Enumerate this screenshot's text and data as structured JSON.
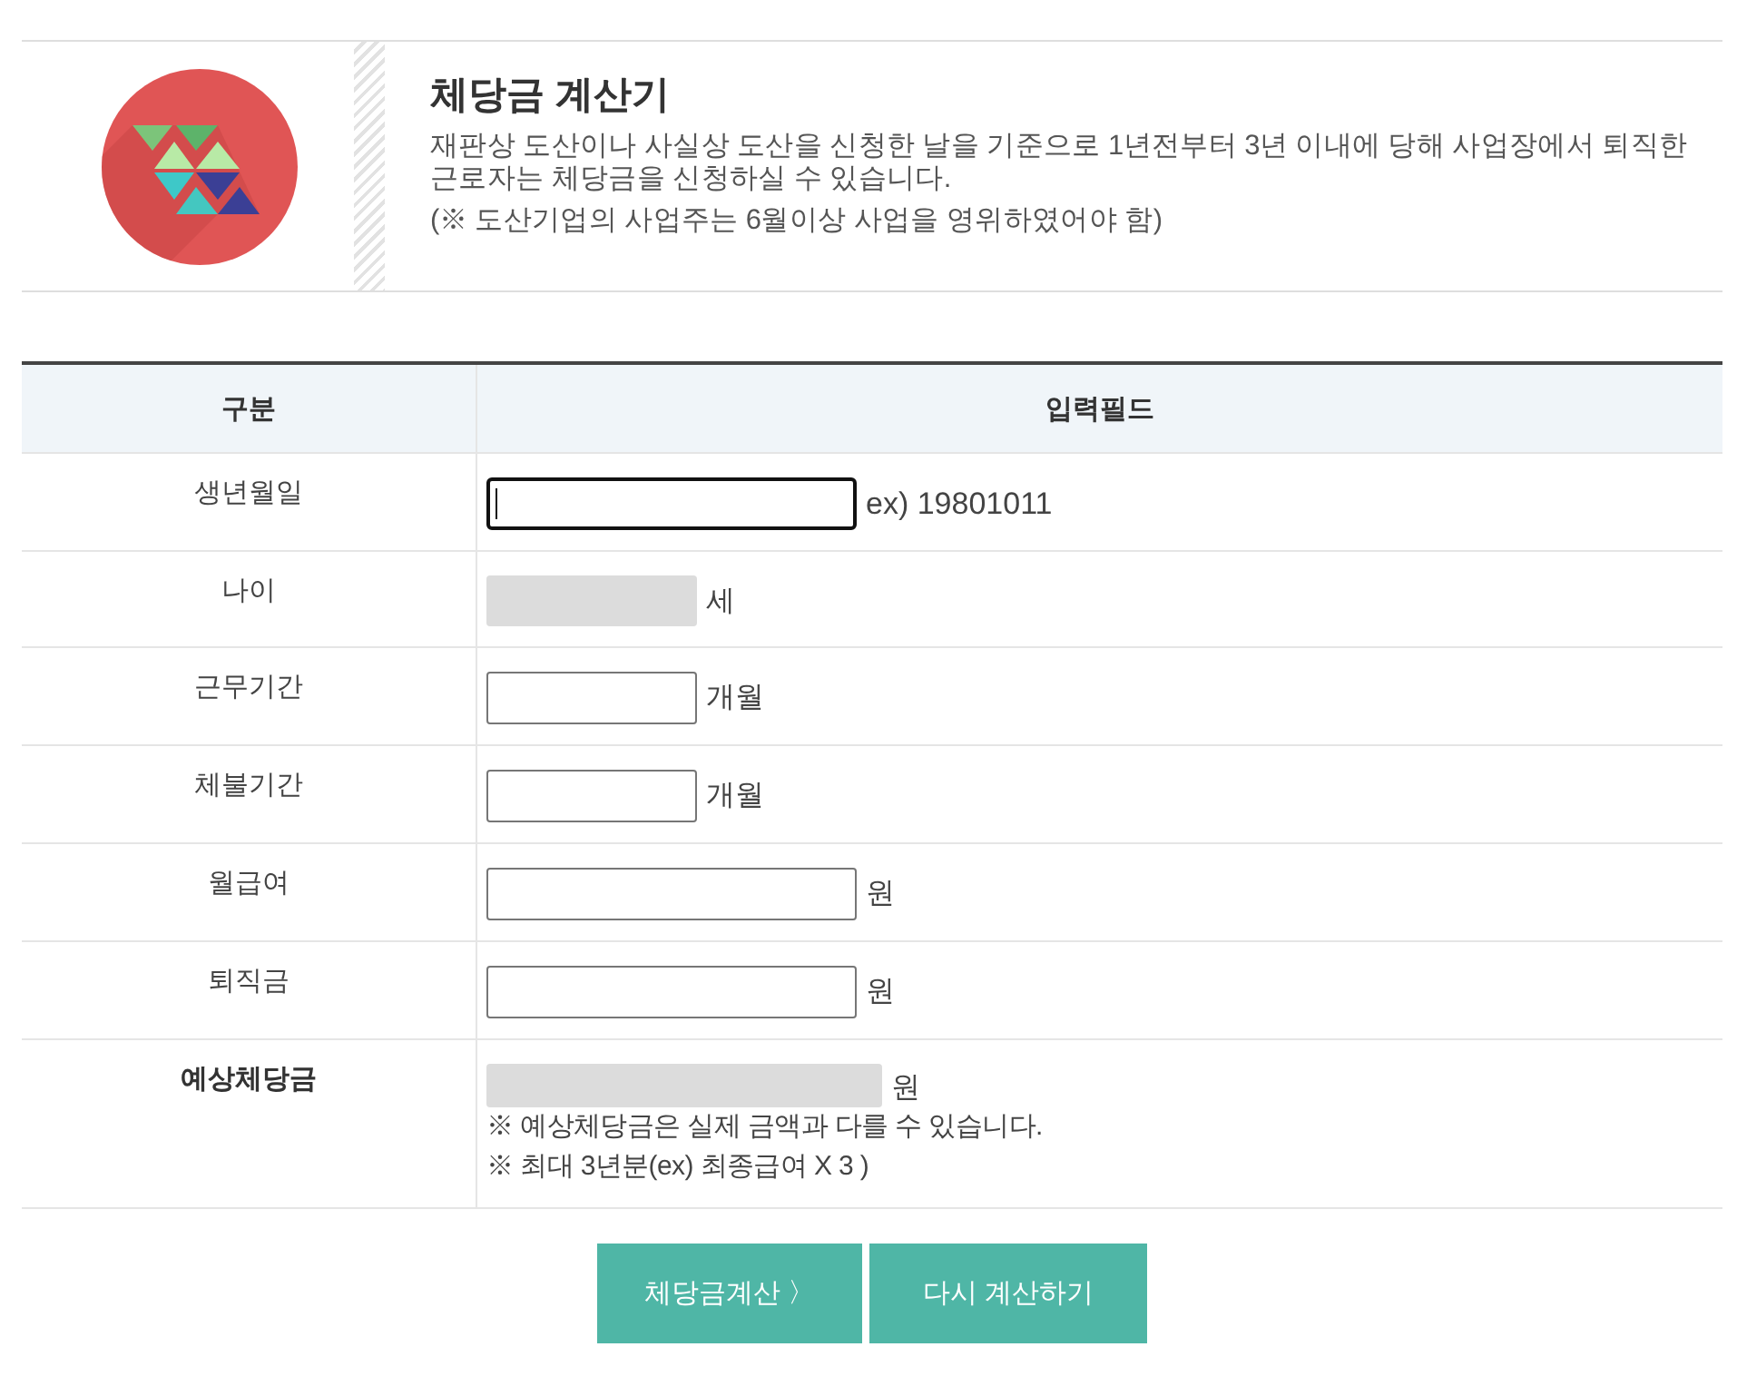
{
  "header": {
    "title": "체당금 계산기",
    "description": "재판상 도산이나 사실상 도산을 신청한 날을 기준으로 1년전부터 3년 이내에 당해 사업장에서 퇴직한 근로자는 체당금을 신청하실 수 있습니다.",
    "note": "(※ 도산기업의 사업주는 6월이상 사업을 영위하였어야 함)"
  },
  "table": {
    "columns": [
      "구분",
      "입력필드"
    ],
    "rows": [
      {
        "label": "생년월일",
        "bold": false,
        "kind": "textbox",
        "focused": true,
        "example": "ex) 19801011"
      },
      {
        "label": "나이",
        "bold": false,
        "kind": "smalldisplay",
        "unit": "세"
      },
      {
        "label": "근무기간",
        "bold": false,
        "kind": "smallbox",
        "focused": false,
        "unit": "개월"
      },
      {
        "label": "체불기간",
        "bold": false,
        "kind": "smallbox",
        "focused": false,
        "unit": "개월"
      },
      {
        "label": "월급여",
        "bold": false,
        "kind": "textbox",
        "focused": false,
        "unit": "원"
      },
      {
        "label": "퇴직금",
        "bold": false,
        "kind": "textbox",
        "focused": false,
        "unit": "원"
      },
      {
        "label": "예상체당금",
        "bold": true,
        "kind": "display",
        "unit": "원",
        "notes": [
          "※ 예상체당금은 실제 금액과 다를 수 있습니다.",
          "※ 최대 3년분(ex) 최종급여 X 3 )"
        ]
      }
    ]
  },
  "buttons": [
    {
      "label": "체당금계산 〉"
    },
    {
      "label": "다시 계산하기"
    }
  ]
}
